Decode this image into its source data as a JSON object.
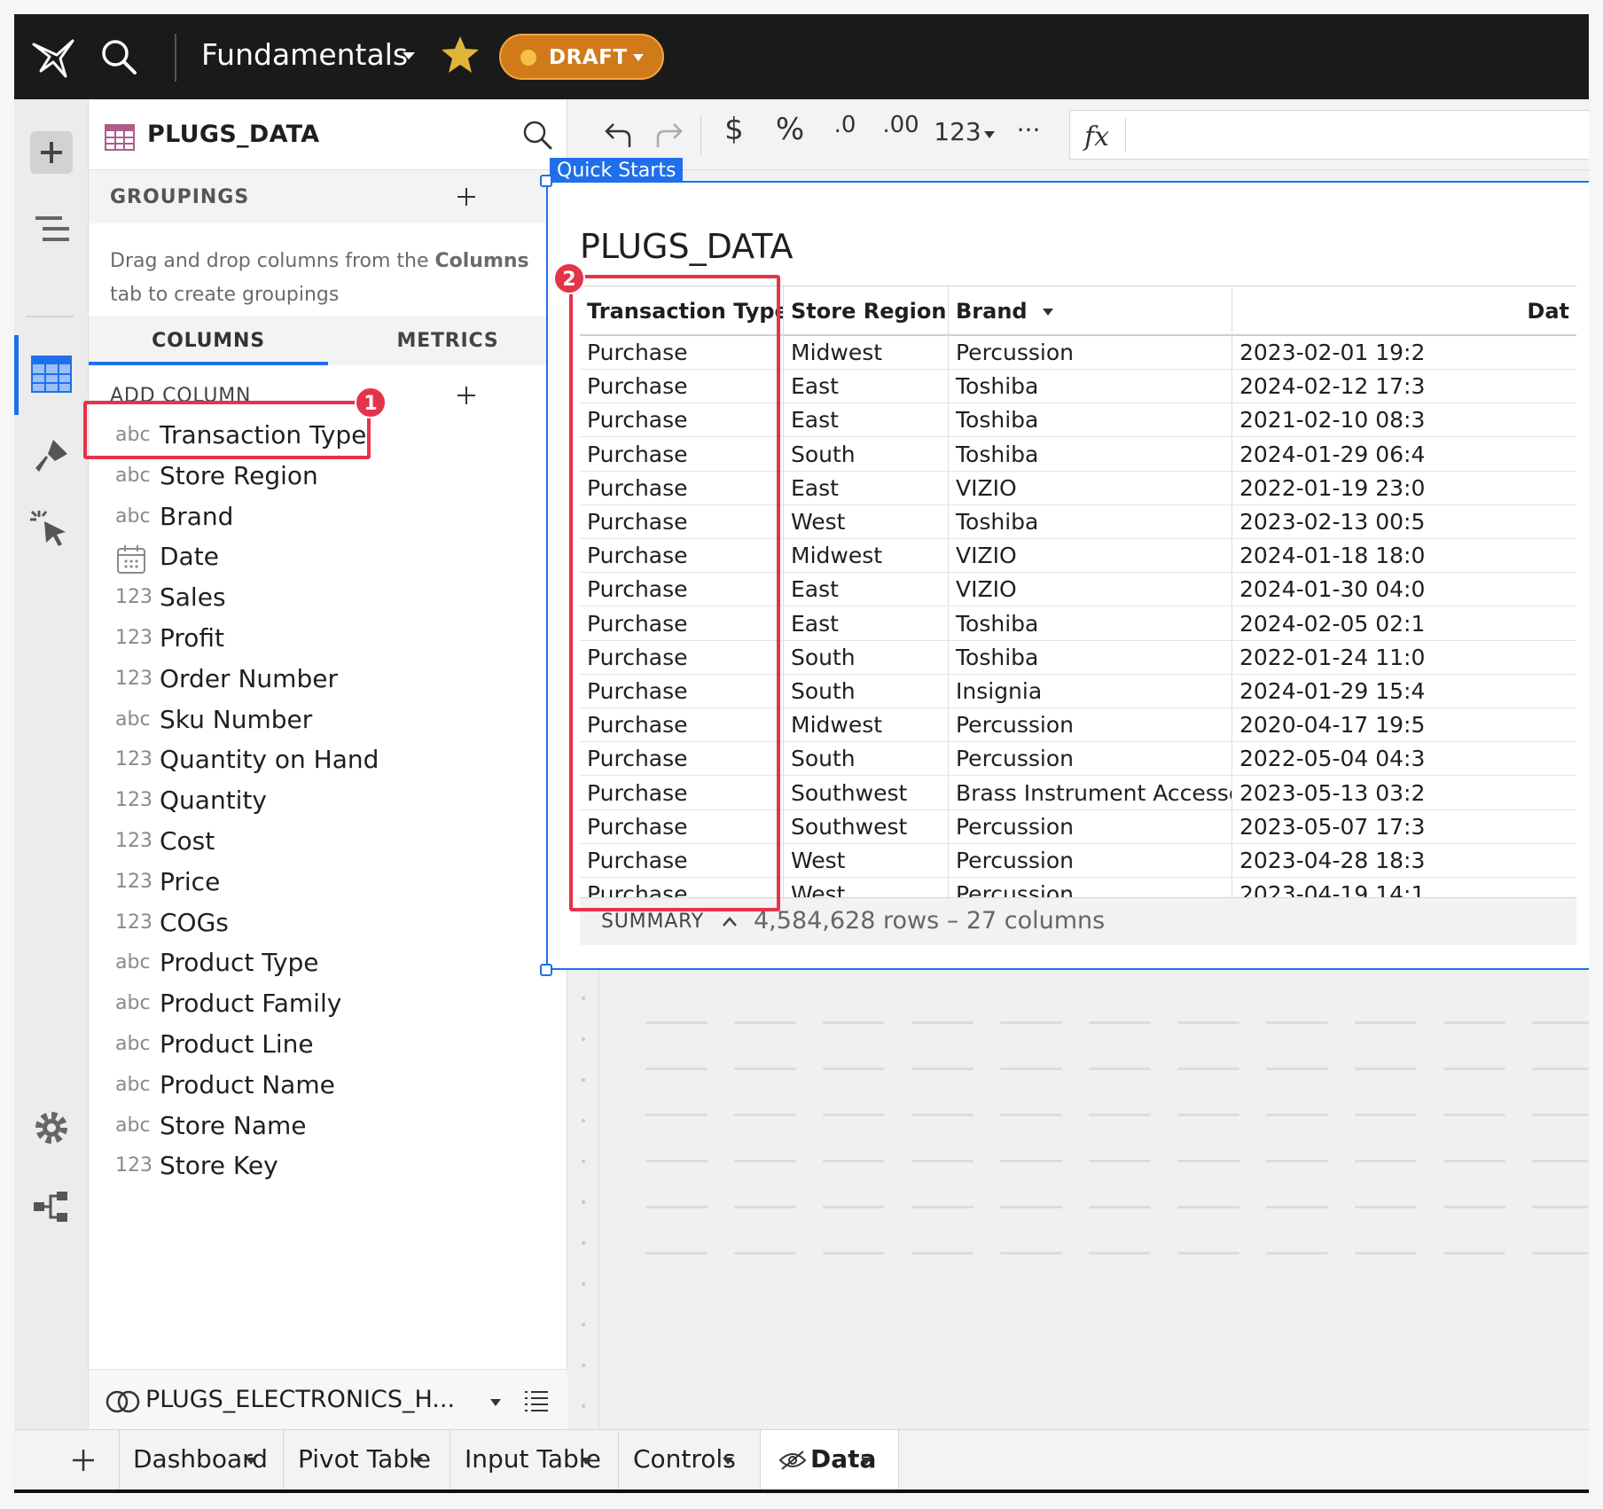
{
  "topbar": {
    "title": "Fundamentals",
    "status": "DRAFT"
  },
  "panel": {
    "title": "PLUGS_DATA",
    "groupings_label": "GROUPINGS",
    "groupings_hint_pre": "Drag and drop columns from the ",
    "groupings_hint_bold": "Columns",
    "groupings_hint_post": " tab to create groupings",
    "tabs": [
      {
        "label": "COLUMNS",
        "active": true
      },
      {
        "label": "METRICS",
        "active": false
      }
    ],
    "add_column_label": "ADD COLUMN",
    "columns": [
      {
        "type": "abc",
        "name": "Transaction Type"
      },
      {
        "type": "abc",
        "name": "Store Region"
      },
      {
        "type": "abc",
        "name": "Brand"
      },
      {
        "type": "calendar",
        "name": "Date"
      },
      {
        "type": "123",
        "name": "Sales"
      },
      {
        "type": "123",
        "name": "Profit"
      },
      {
        "type": "123",
        "name": "Order Number"
      },
      {
        "type": "abc",
        "name": "Sku Number"
      },
      {
        "type": "123",
        "name": "Quantity on Hand"
      },
      {
        "type": "123",
        "name": "Quantity"
      },
      {
        "type": "123",
        "name": "Cost"
      },
      {
        "type": "123",
        "name": "Price"
      },
      {
        "type": "123",
        "name": "COGs"
      },
      {
        "type": "abc",
        "name": "Product Type"
      },
      {
        "type": "abc",
        "name": "Product Family"
      },
      {
        "type": "abc",
        "name": "Product Line"
      },
      {
        "type": "abc",
        "name": "Product Name"
      },
      {
        "type": "abc",
        "name": "Store Name"
      },
      {
        "type": "123",
        "name": "Store Key"
      }
    ],
    "datasource": "PLUGS_ELECTRONICS_H..."
  },
  "toolbar": {
    "currency": "$",
    "percent": "%",
    "dec_decrease": ".0",
    "dec_increase": ".00",
    "number_format": "123",
    "more": "···",
    "fx": "fx"
  },
  "element": {
    "tag": "Quick Starts",
    "title": "PLUGS_DATA",
    "columns": [
      "Transaction Type",
      "Store Region",
      "Brand",
      "Dat"
    ],
    "rows": [
      [
        "Purchase",
        "Midwest",
        "Percussion",
        "2023-02-01 19:2"
      ],
      [
        "Purchase",
        "East",
        "Toshiba",
        "2024-02-12 17:3"
      ],
      [
        "Purchase",
        "East",
        "Toshiba",
        "2021-02-10 08:3"
      ],
      [
        "Purchase",
        "South",
        "Toshiba",
        "2024-01-29 06:4"
      ],
      [
        "Purchase",
        "East",
        "VIZIO",
        "2022-01-19 23:0"
      ],
      [
        "Purchase",
        "West",
        "Toshiba",
        "2023-02-13 00:5"
      ],
      [
        "Purchase",
        "Midwest",
        "VIZIO",
        "2024-01-18 18:0"
      ],
      [
        "Purchase",
        "East",
        "VIZIO",
        "2024-01-30 04:0"
      ],
      [
        "Purchase",
        "East",
        "Toshiba",
        "2024-02-05 02:1"
      ],
      [
        "Purchase",
        "South",
        "Toshiba",
        "2022-01-24 11:0"
      ],
      [
        "Purchase",
        "South",
        "Insignia",
        "2024-01-29 15:4"
      ],
      [
        "Purchase",
        "Midwest",
        "Percussion",
        "2020-04-17 19:5"
      ],
      [
        "Purchase",
        "South",
        "Percussion",
        "2022-05-04 04:3"
      ],
      [
        "Purchase",
        "Southwest",
        "Brass Instrument Accessories",
        "2023-05-13 03:2"
      ],
      [
        "Purchase",
        "Southwest",
        "Percussion",
        "2023-05-07 17:3"
      ],
      [
        "Purchase",
        "West",
        "Percussion",
        "2023-04-28 18:3"
      ],
      [
        "Purchase",
        "West",
        "Percussion",
        "2023-04-19 14:1"
      ]
    ],
    "summary_label": "SUMMARY",
    "summary_info": "4,584,628 rows – 27 columns"
  },
  "annotations": [
    "1",
    "2"
  ],
  "bottom_tabs": [
    {
      "label": "Dashboard",
      "active": false
    },
    {
      "label": "Pivot Table",
      "active": false
    },
    {
      "label": "Input Table",
      "active": false
    },
    {
      "label": "Controls",
      "active": false
    },
    {
      "label": "Data",
      "active": true
    }
  ],
  "colors": {
    "accent": "#1f6feb",
    "annotation": "#e5334a",
    "draft": "#d17a1a",
    "topbar": "#1a1a1a"
  }
}
